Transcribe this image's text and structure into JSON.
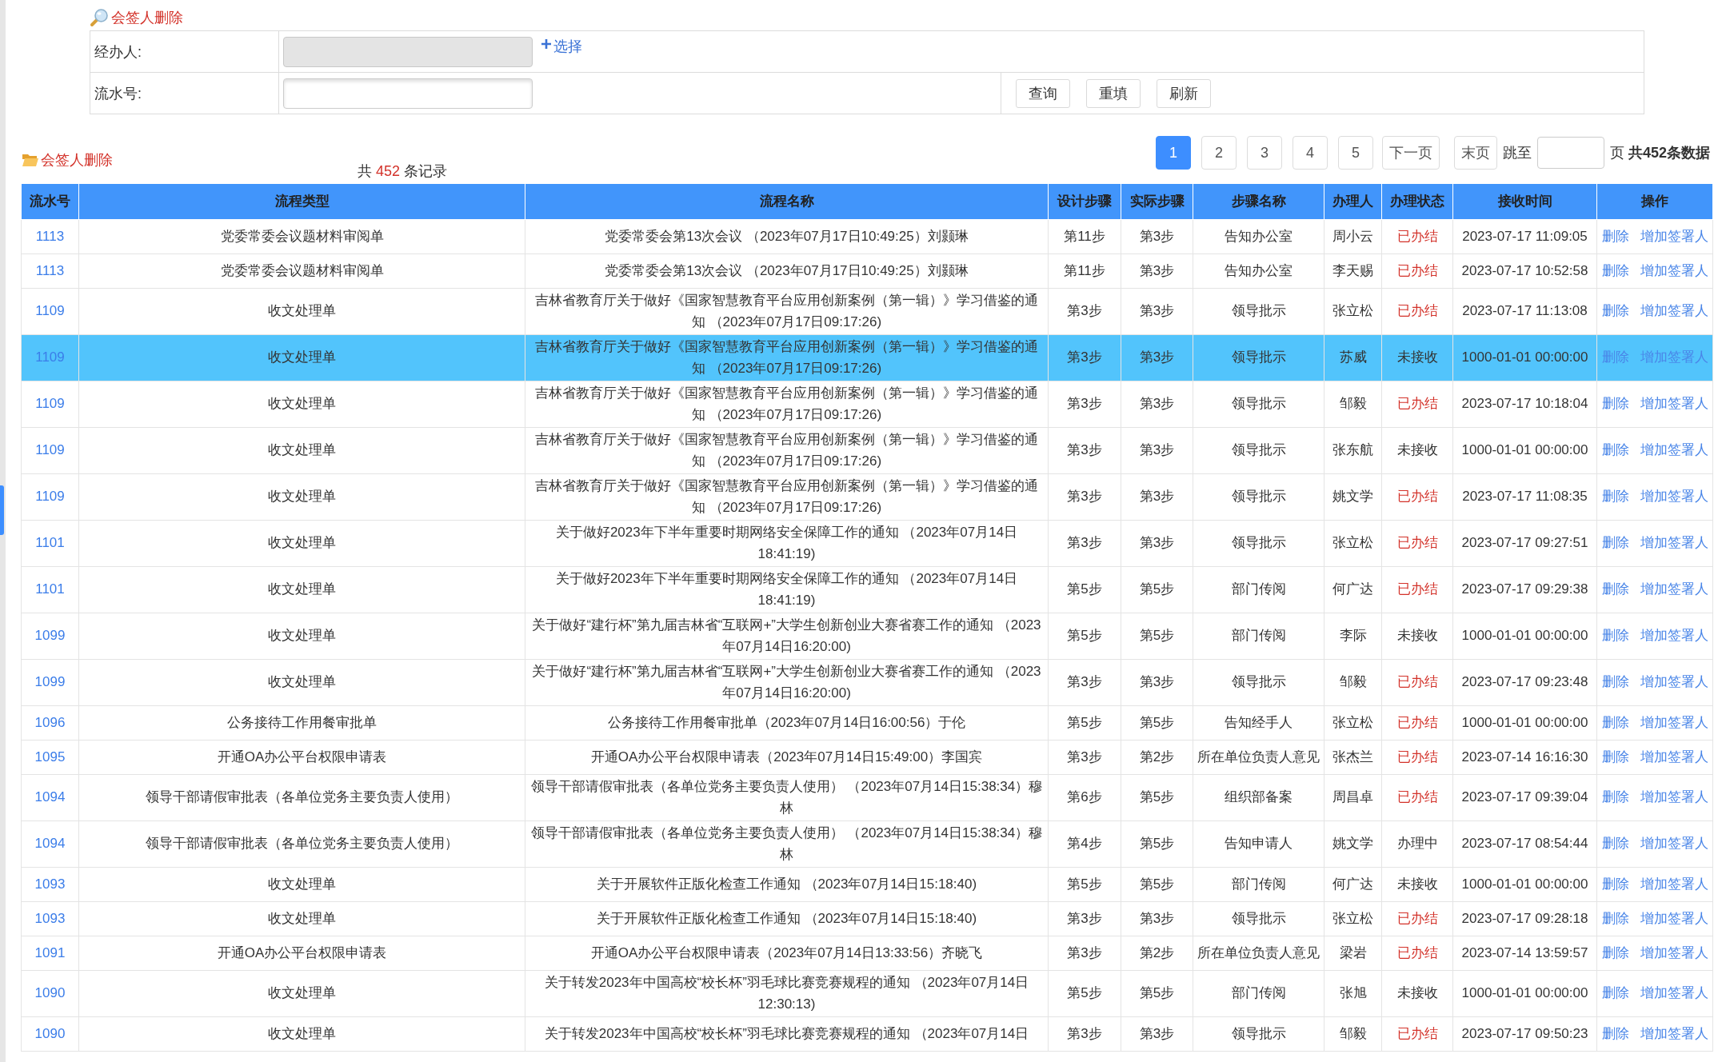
{
  "search": {
    "title": "会签人删除",
    "rows": [
      {
        "label": "经办人:",
        "input": {
          "disabled": true
        },
        "link": "选择"
      },
      {
        "label": "流水号:",
        "input": {
          "disabled": false
        },
        "buttons": [
          "查询",
          "重填",
          "刷新"
        ]
      }
    ]
  },
  "list": {
    "title": "会签人删除",
    "record_count": {
      "prefix": "共",
      "count": "452",
      "suffix": "条记录"
    }
  },
  "pagination": {
    "pages": [
      {
        "label": "1",
        "selected": true
      },
      {
        "label": "2",
        "selected": false
      },
      {
        "label": "3",
        "selected": false
      },
      {
        "label": "4",
        "selected": false
      },
      {
        "label": "5",
        "selected": false
      }
    ],
    "next": "下一页",
    "last": "末页",
    "jump_label": "跳至",
    "total": "页 **共452条数据**"
  },
  "table": {
    "columns": [
      "流水号",
      "流程类型",
      "流程名称",
      "设计步骤",
      "实际步骤",
      "步骤名称",
      "办理人",
      "办理状态",
      "接收时间",
      "操作"
    ],
    "rows": [
      {
        "id": "1113",
        "type": "党委常委会议题材料审阅单",
        "name": "党委常委会第13次会议 （2023年07月17日10:49:25）刘颢琳",
        "design_step": "第11步",
        "actual_step": "第3步",
        "step_name": "告知办公室",
        "handler": "周小云",
        "status": "已办结",
        "completed": true,
        "received": "2023-07-17 11:09:05",
        "actions": [
          "删除",
          "增加签署人"
        ],
        "selected": false
      },
      {
        "id": "1113",
        "type": "党委常委会议题材料审阅单",
        "name": "党委常委会第13次会议 （2023年07月17日10:49:25）刘颢琳",
        "design_step": "第11步",
        "actual_step": "第3步",
        "step_name": "告知办公室",
        "handler": "李天赐",
        "status": "已办结",
        "completed": true,
        "received": "2023-07-17 10:52:58",
        "actions": [
          "删除",
          "增加签署人"
        ],
        "selected": false
      },
      {
        "id": "1109",
        "type": "收文处理单",
        "name": "吉林省教育厅关于做好《国家智慧教育平台应用创新案例（第一辑）》学习借鉴的通知 （2023年07月17日09:17:26)",
        "design_step": "第3步",
        "actual_step": "第3步",
        "step_name": "领导批示",
        "handler": "张立松",
        "status": "已办结",
        "completed": true,
        "received": "2023-07-17 11:13:08",
        "actions": [
          "删除",
          "增加签署人"
        ],
        "selected": false
      },
      {
        "id": "1109",
        "type": "收文处理单",
        "name": "吉林省教育厅关于做好《国家智慧教育平台应用创新案例（第一辑）》学习借鉴的通知 （2023年07月17日09:17:26)",
        "design_step": "第3步",
        "actual_step": "第3步",
        "step_name": "领导批示",
        "handler": "苏威",
        "status": "未接收",
        "completed": false,
        "received": "1000-01-01 00:00:00",
        "actions": [
          "删除",
          "增加签署人"
        ],
        "selected": true
      },
      {
        "id": "1109",
        "type": "收文处理单",
        "name": "吉林省教育厅关于做好《国家智慧教育平台应用创新案例（第一辑）》学习借鉴的通知 （2023年07月17日09:17:26)",
        "design_step": "第3步",
        "actual_step": "第3步",
        "step_name": "领导批示",
        "handler": "邹毅",
        "status": "已办结",
        "completed": true,
        "received": "2023-07-17 10:18:04",
        "actions": [
          "删除",
          "增加签署人"
        ],
        "selected": false
      },
      {
        "id": "1109",
        "type": "收文处理单",
        "name": "吉林省教育厅关于做好《国家智慧教育平台应用创新案例（第一辑）》学习借鉴的通知 （2023年07月17日09:17:26)",
        "design_step": "第3步",
        "actual_step": "第3步",
        "step_name": "领导批示",
        "handler": "张东航",
        "status": "未接收",
        "completed": false,
        "received": "1000-01-01 00:00:00",
        "actions": [
          "删除",
          "增加签署人"
        ],
        "selected": false
      },
      {
        "id": "1109",
        "type": "收文处理单",
        "name": "吉林省教育厅关于做好《国家智慧教育平台应用创新案例（第一辑）》学习借鉴的通知 （2023年07月17日09:17:26)",
        "design_step": "第3步",
        "actual_step": "第3步",
        "step_name": "领导批示",
        "handler": "姚文学",
        "status": "已办结",
        "completed": true,
        "received": "2023-07-17 11:08:35",
        "actions": [
          "删除",
          "增加签署人"
        ],
        "selected": false
      },
      {
        "id": "1101",
        "type": "收文处理单",
        "name": "关于做好2023年下半年重要时期网络安全保障工作的通知 （2023年07月14日18:41:19)",
        "design_step": "第3步",
        "actual_step": "第3步",
        "step_name": "领导批示",
        "handler": "张立松",
        "status": "已办结",
        "completed": true,
        "received": "2023-07-17 09:27:51",
        "actions": [
          "删除",
          "增加签署人"
        ],
        "selected": false
      },
      {
        "id": "1101",
        "type": "收文处理单",
        "name": "关于做好2023年下半年重要时期网络安全保障工作的通知 （2023年07月14日18:41:19)",
        "design_step": "第5步",
        "actual_step": "第5步",
        "step_name": "部门传阅",
        "handler": "何广达",
        "status": "已办结",
        "completed": true,
        "received": "2023-07-17 09:29:38",
        "actions": [
          "删除",
          "增加签署人"
        ],
        "selected": false
      },
      {
        "id": "1099",
        "type": "收文处理单",
        "name": "关于做好“建行杯”第九届吉林省“互联网+”大学生创新创业大赛省赛工作的通知 （2023年07月14日16:20:00)",
        "design_step": "第5步",
        "actual_step": "第5步",
        "step_name": "部门传阅",
        "handler": "李际",
        "status": "未接收",
        "completed": false,
        "received": "1000-01-01 00:00:00",
        "actions": [
          "删除",
          "增加签署人"
        ],
        "selected": false
      },
      {
        "id": "1099",
        "type": "收文处理单",
        "name": "关于做好“建行杯”第九届吉林省“互联网+”大学生创新创业大赛省赛工作的通知 （2023年07月14日16:20:00)",
        "design_step": "第3步",
        "actual_step": "第3步",
        "step_name": "领导批示",
        "handler": "邹毅",
        "status": "已办结",
        "completed": true,
        "received": "2023-07-17 09:23:48",
        "actions": [
          "删除",
          "增加签署人"
        ],
        "selected": false
      },
      {
        "id": "1096",
        "type": "公务接待工作用餐审批单",
        "name": "公务接待工作用餐审批单（2023年07月14日16:00:56）于伦",
        "design_step": "第5步",
        "actual_step": "第5步",
        "step_name": "告知经手人",
        "handler": "张立松",
        "status": "已办结",
        "completed": true,
        "received": "1000-01-01 00:00:00",
        "actions": [
          "删除",
          "增加签署人"
        ],
        "selected": false
      },
      {
        "id": "1095",
        "type": "开通OA办公平台权限申请表",
        "name": "开通OA办公平台权限申请表（2023年07月14日15:49:00）李国宾",
        "design_step": "第3步",
        "actual_step": "第2步",
        "step_name": "所在单位负责人意见",
        "handler": "张杰兰",
        "status": "已办结",
        "completed": true,
        "received": "2023-07-14 16:16:30",
        "actions": [
          "删除",
          "增加签署人"
        ],
        "selected": false
      },
      {
        "id": "1094",
        "type": "领导干部请假审批表（各单位党务主要负责人使用）",
        "name": "领导干部请假审批表（各单位党务主要负责人使用） （2023年07月14日15:38:34）穆林",
        "design_step": "第6步",
        "actual_step": "第5步",
        "step_name": "组织部备案",
        "handler": "周昌卓",
        "status": "已办结",
        "completed": true,
        "received": "2023-07-17 09:39:04",
        "actions": [
          "删除",
          "增加签署人"
        ],
        "selected": false
      },
      {
        "id": "1094",
        "type": "领导干部请假审批表（各单位党务主要负责人使用）",
        "name": "领导干部请假审批表（各单位党务主要负责人使用） （2023年07月14日15:38:34）穆林",
        "design_step": "第4步",
        "actual_step": "第5步",
        "step_name": "告知申请人",
        "handler": "姚文学",
        "status": "办理中",
        "completed": false,
        "received": "2023-07-17 08:54:44",
        "actions": [
          "删除",
          "增加签署人"
        ],
        "selected": false
      },
      {
        "id": "1093",
        "type": "收文处理单",
        "name": "关于开展软件正版化检查工作通知 （2023年07月14日15:18:40)",
        "design_step": "第5步",
        "actual_step": "第5步",
        "step_name": "部门传阅",
        "handler": "何广达",
        "status": "未接收",
        "completed": false,
        "received": "1000-01-01 00:00:00",
        "actions": [
          "删除",
          "增加签署人"
        ],
        "selected": false
      },
      {
        "id": "1093",
        "type": "收文处理单",
        "name": "关于开展软件正版化检查工作通知 （2023年07月14日15:18:40)",
        "design_step": "第3步",
        "actual_step": "第3步",
        "step_name": "领导批示",
        "handler": "张立松",
        "status": "已办结",
        "completed": true,
        "received": "2023-07-17 09:28:18",
        "actions": [
          "删除",
          "增加签署人"
        ],
        "selected": false
      },
      {
        "id": "1091",
        "type": "开通OA办公平台权限申请表",
        "name": "开通OA办公平台权限申请表（2023年07月14日13:33:56）齐晓飞",
        "design_step": "第3步",
        "actual_step": "第2步",
        "step_name": "所在单位负责人意见",
        "handler": "梁岩",
        "status": "已办结",
        "completed": true,
        "received": "2023-07-14 13:59:57",
        "actions": [
          "删除",
          "增加签署人"
        ],
        "selected": false
      },
      {
        "id": "1090",
        "type": "收文处理单",
        "name": "关于转发2023年中国高校“校长杯”羽毛球比赛竞赛规程的通知 （2023年07月14日12:30:13)",
        "design_step": "第5步",
        "actual_step": "第5步",
        "step_name": "部门传阅",
        "handler": "张旭",
        "status": "未接收",
        "completed": false,
        "received": "1000-01-01 00:00:00",
        "actions": [
          "删除",
          "增加签署人"
        ],
        "selected": false
      },
      {
        "id": "1090",
        "type": "收文处理单",
        "name": "关于转发2023年中国高校“校长杯”羽毛球比赛竞赛规程的通知 （2023年07月14日",
        "design_step": "第3步",
        "actual_step": "第3步",
        "step_name": "领导批示",
        "handler": "邹毅",
        "status": "已办结",
        "completed": true,
        "received": "2023-07-17 09:50:23",
        "actions": [
          "删除",
          "增加签署人"
        ],
        "selected": false
      }
    ]
  }
}
